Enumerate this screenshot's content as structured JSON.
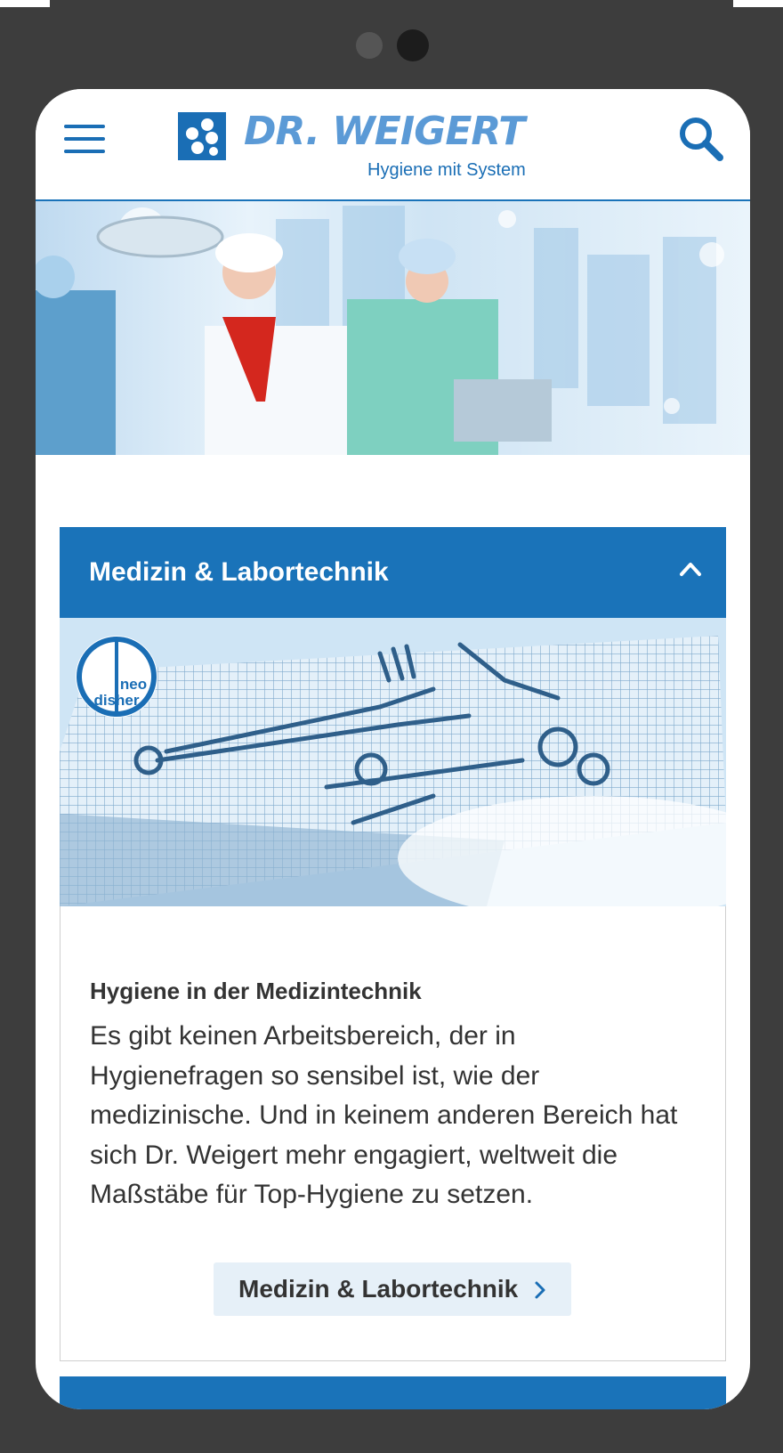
{
  "header": {
    "logo_name": "DR. WEIGERT",
    "logo_tagline": "Hygiene mit System",
    "menu_icon": "hamburger-menu-icon",
    "search_icon": "search-icon",
    "brand_color": "#1a73b9"
  },
  "accordion": {
    "title": "Medizin & Labortechnik",
    "expanded": true,
    "toggle_icon": "chevron-up-icon",
    "badge_brand": "neodisher",
    "subtitle": "Hygiene in der Medizintechnik",
    "text": "Es gibt keinen Arbeitsbereich, der in Hygienefragen so sensibel ist, wie der medizinische. Und in keinem anderen Bereich hat sich Dr. Weigert mehr engagiert, weltweit die Maßstäbe für Top-Hygiene zu setzen.",
    "button_label": "Medizin & Labortechnik",
    "button_icon": "chevron-right-icon"
  }
}
